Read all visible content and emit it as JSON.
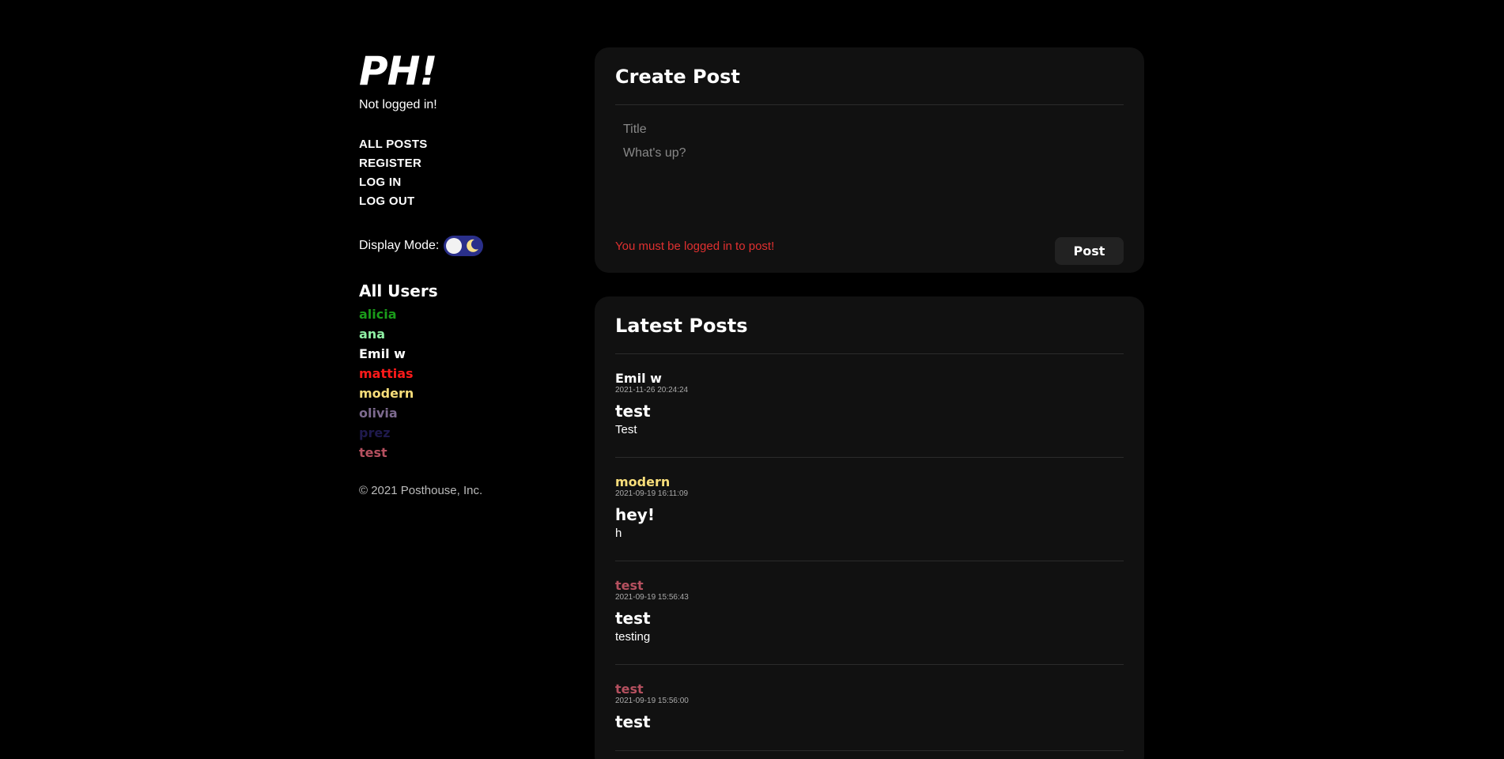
{
  "sidebar": {
    "logo": "PH!",
    "login_status": "Not logged in!",
    "nav": {
      "all_posts": "ALL POSTS",
      "register": "REGISTER",
      "log_in": "LOG IN",
      "log_out": "LOG OUT"
    },
    "display_mode_label": "Display Mode:",
    "users_heading": "All Users",
    "users": [
      {
        "name": "alicia",
        "color": "#1a9c1a"
      },
      {
        "name": "ana",
        "color": "#8ff0a4"
      },
      {
        "name": "Emil w",
        "color": "#ffffff"
      },
      {
        "name": "mattias",
        "color": "#ff1a1a"
      },
      {
        "name": "modern",
        "color": "#f7dd7a"
      },
      {
        "name": "olivia",
        "color": "#7d6a8f"
      },
      {
        "name": "prez",
        "color": "#1f1a4d"
      },
      {
        "name": "test",
        "color": "#b5505f"
      }
    ],
    "copyright": "© 2021 Posthouse, Inc."
  },
  "create_post": {
    "heading": "Create Post",
    "title_placeholder": "Title",
    "body_placeholder": "What's up?",
    "error": "You must be logged in to post!",
    "post_button": "Post"
  },
  "latest_posts": {
    "heading": "Latest Posts",
    "posts": [
      {
        "author": "Emil w",
        "author_color": "#ffffff",
        "date": "2021-11-26 20:24:24",
        "title": "test",
        "body": "Test"
      },
      {
        "author": "modern",
        "author_color": "#f7dd7a",
        "date": "2021-09-19 16:11:09",
        "title": "hey!",
        "body": "h"
      },
      {
        "author": "test",
        "author_color": "#b5505f",
        "date": "2021-09-19 15:56:43",
        "title": "test",
        "body": "testing"
      },
      {
        "author": "test",
        "author_color": "#b5505f",
        "date": "2021-09-19 15:56:00",
        "title": "test",
        "body": ""
      }
    ]
  },
  "icons": {
    "toggle_sun": "sun-icon",
    "toggle_moon": "moon-icon"
  }
}
